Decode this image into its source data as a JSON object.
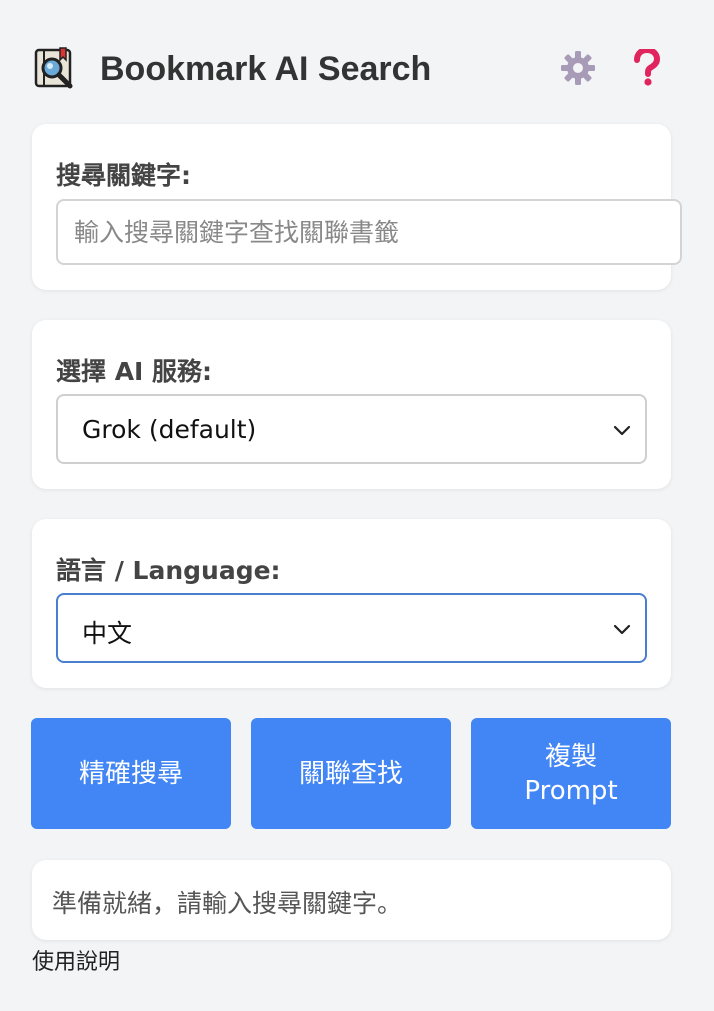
{
  "header": {
    "title": "Bookmark AI Search",
    "logo_icon": "bookmark-magnifier-icon",
    "settings_icon": "gear-icon",
    "help_icon": "question-mark-icon",
    "help_color": "#e0245e"
  },
  "search": {
    "label": "搜尋關鍵字:",
    "placeholder": "輸入搜尋關鍵字查找關聯書籤",
    "value": ""
  },
  "ai_service": {
    "label": "選擇 AI 服務:",
    "selected": "Grok (default)"
  },
  "language": {
    "label": "語言 / Language:",
    "selected": "中文"
  },
  "buttons": {
    "exact_search": "精確搜尋",
    "related_search": "關聯查找",
    "copy_prompt_line1": "複製",
    "copy_prompt_line2": "Prompt"
  },
  "status": {
    "text": "準備就緒，請輸入搜尋關鍵字。"
  },
  "footer": {
    "usage_link": "使用說明"
  },
  "colors": {
    "accent": "#4285f4",
    "background": "#f3f4f6",
    "focus_border": "#4a7fd0"
  }
}
